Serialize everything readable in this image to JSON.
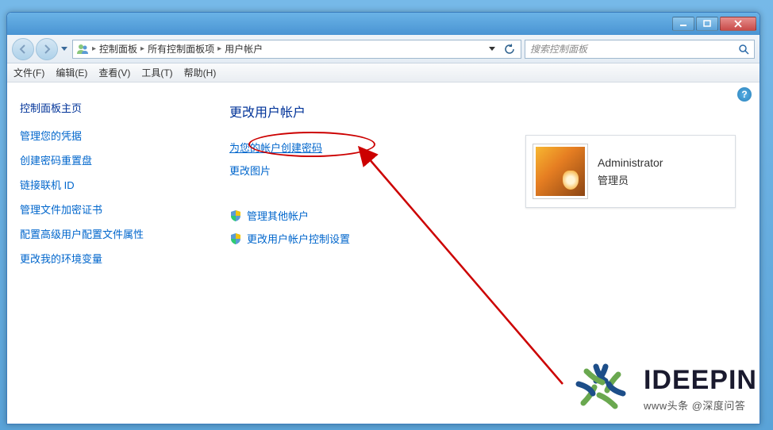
{
  "titlebar": {
    "min_label": "—",
    "max_label": "▢",
    "close_label": "✕"
  },
  "breadcrumb": {
    "root": "控制面板",
    "level2": "所有控制面板项",
    "level3": "用户帐户"
  },
  "search": {
    "placeholder": "搜索控制面板"
  },
  "menubar": {
    "file": "文件(F)",
    "edit": "编辑(E)",
    "view": "查看(V)",
    "tools": "工具(T)",
    "help": "帮助(H)"
  },
  "sidebar": {
    "title": "控制面板主页",
    "links": [
      "管理您的凭据",
      "创建密码重置盘",
      "链接联机 ID",
      "管理文件加密证书",
      "配置高级用户配置文件属性",
      "更改我的环境变量"
    ]
  },
  "main": {
    "title": "更改用户帐户",
    "tasks": {
      "create_password": "为您的帐户创建密码",
      "change_picture": "更改图片",
      "manage_other": "管理其他帐户",
      "change_uac": "更改用户帐户控制设置"
    }
  },
  "account": {
    "name": "Administrator",
    "type": "管理员"
  },
  "help_char": "?",
  "watermark": {
    "title": "IDEEPIN",
    "sub": "www头条 @深度问答"
  }
}
